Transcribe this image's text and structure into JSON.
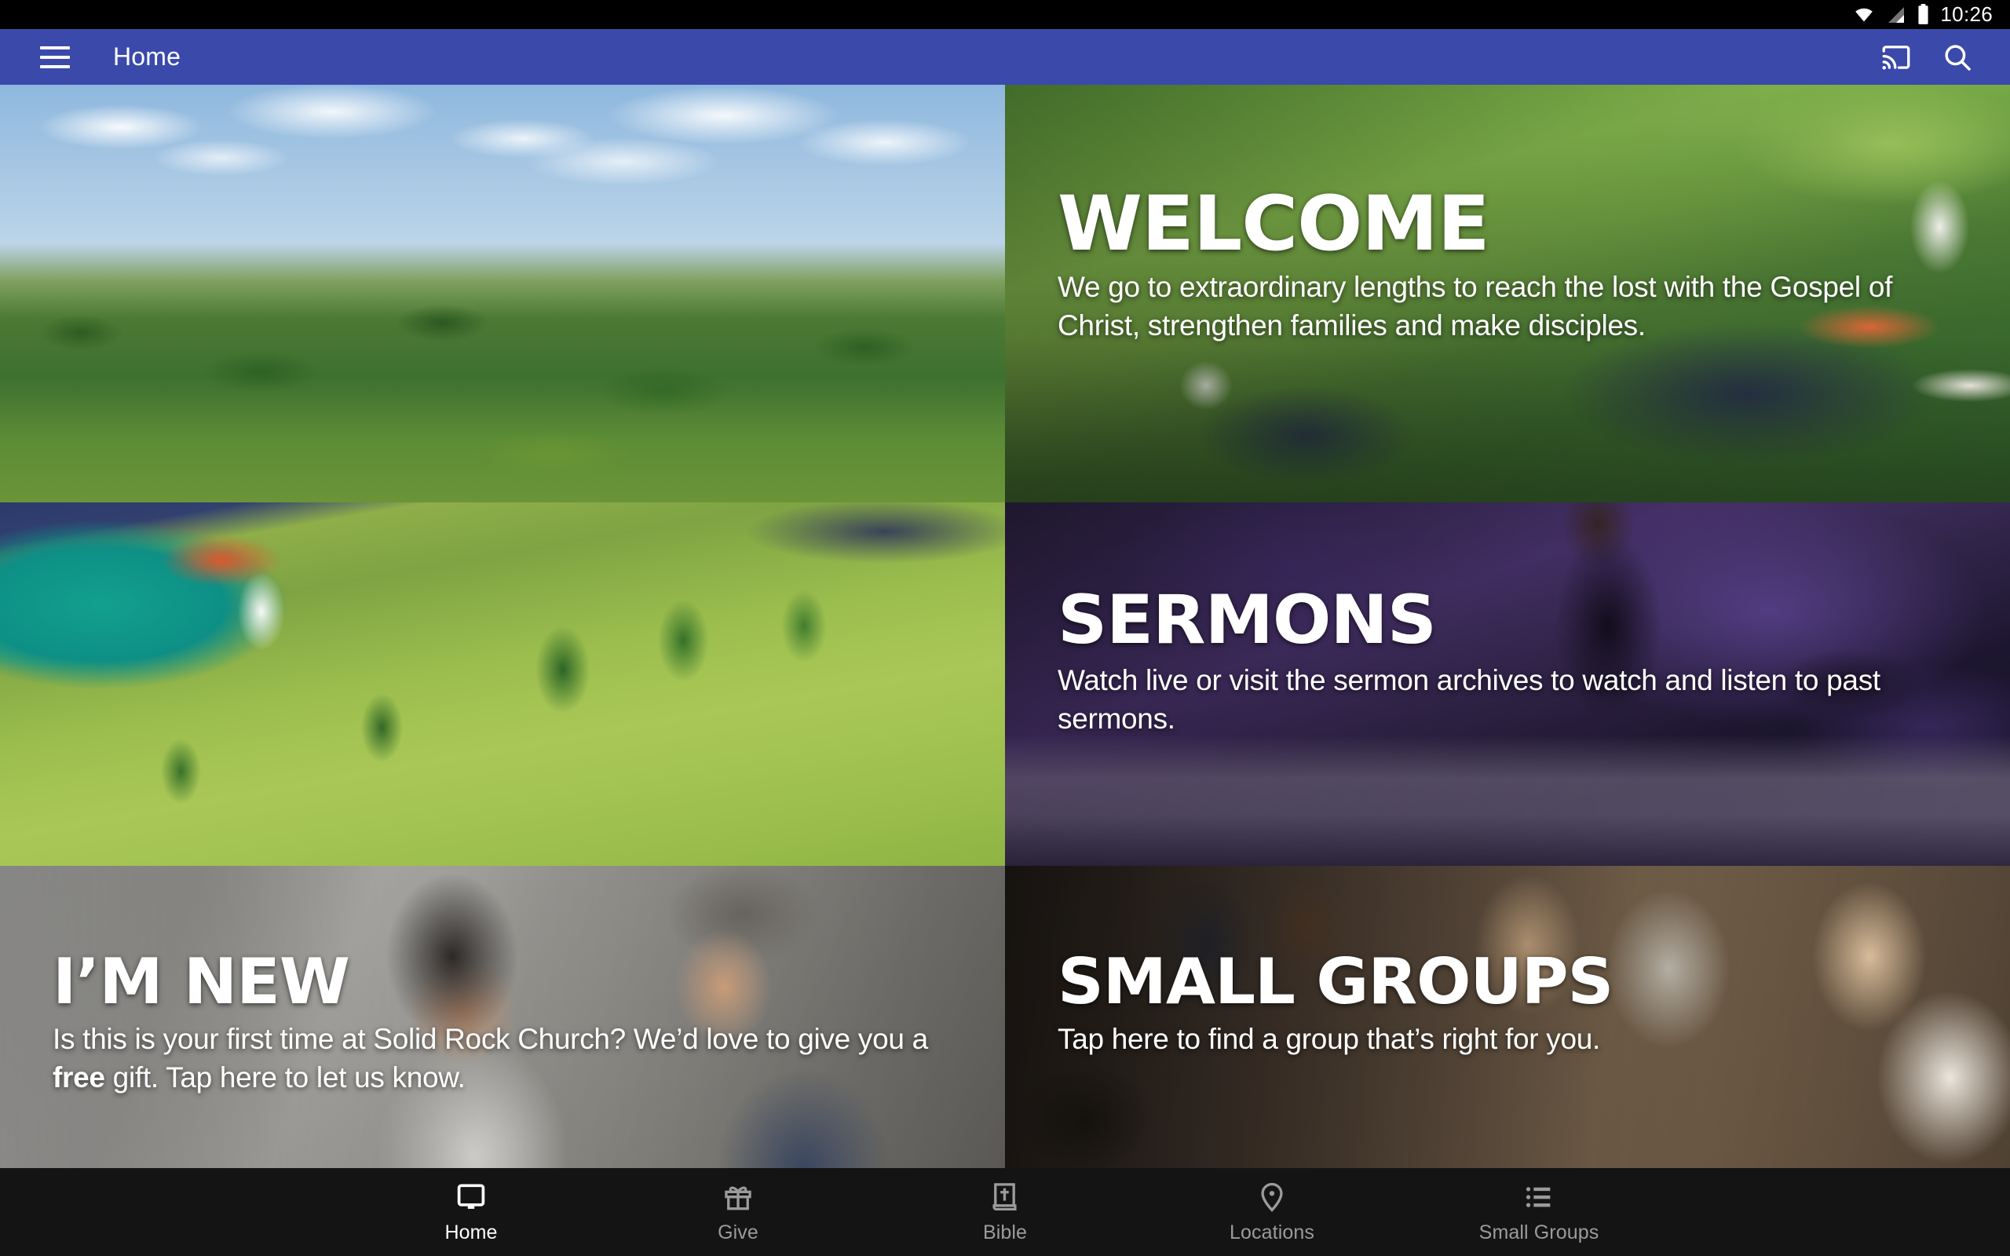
{
  "status_bar": {
    "wifi_icon": "wifi-icon",
    "signal_icon": "cell-signal-icon",
    "battery_icon": "battery-full-icon",
    "clock": "10:26"
  },
  "app_bar": {
    "menu_icon": "hamburger-menu-icon",
    "title": "Home",
    "cast_icon": "cast-icon",
    "search_icon": "search-icon",
    "background_color": "#3b49ab"
  },
  "tiles": [
    {
      "id": "photo-campus-aerial",
      "art": "art-aerial1",
      "heading": "",
      "subtitle": ""
    },
    {
      "id": "welcome",
      "art": "art-welcome",
      "heading": "WELCOME",
      "subtitle": "We go to extraordinary lengths to reach the lost with the Gospel of Christ, strengthen families and make disciples."
    },
    {
      "id": "photo-pond-lawn",
      "art": "art-aerial2",
      "heading": "",
      "subtitle": ""
    },
    {
      "id": "sermons",
      "art": "art-sermons",
      "heading": "SERMONS",
      "subtitle": "Watch live or visit the sermon archives to watch and listen to past sermons."
    },
    {
      "id": "im-new",
      "art": "art-imnew",
      "heading": "I’M NEW",
      "subtitle_part1": "Is this is your first time at Solid Rock Church? We’d love to give you a ",
      "subtitle_bold": "free",
      "subtitle_part2": " gift. Tap here to let us know."
    },
    {
      "id": "small-groups",
      "art": "art-smallgroups",
      "heading": "SMALL GROUPS",
      "subtitle": "Tap here to find a group that’s right for you."
    }
  ],
  "bottom_nav": {
    "items": [
      {
        "label": "Home",
        "icon": "tv-monitor-icon",
        "active": true
      },
      {
        "label": "Give",
        "icon": "gift-icon",
        "active": false
      },
      {
        "label": "Bible",
        "icon": "bible-book-icon",
        "active": false
      },
      {
        "label": "Locations",
        "icon": "map-pin-icon",
        "active": false
      },
      {
        "label": "Small Groups",
        "icon": "list-icon",
        "active": false
      }
    ],
    "active_color": "#ffffff",
    "inactive_color": "#9b9b9b",
    "background_color": "#141414"
  }
}
